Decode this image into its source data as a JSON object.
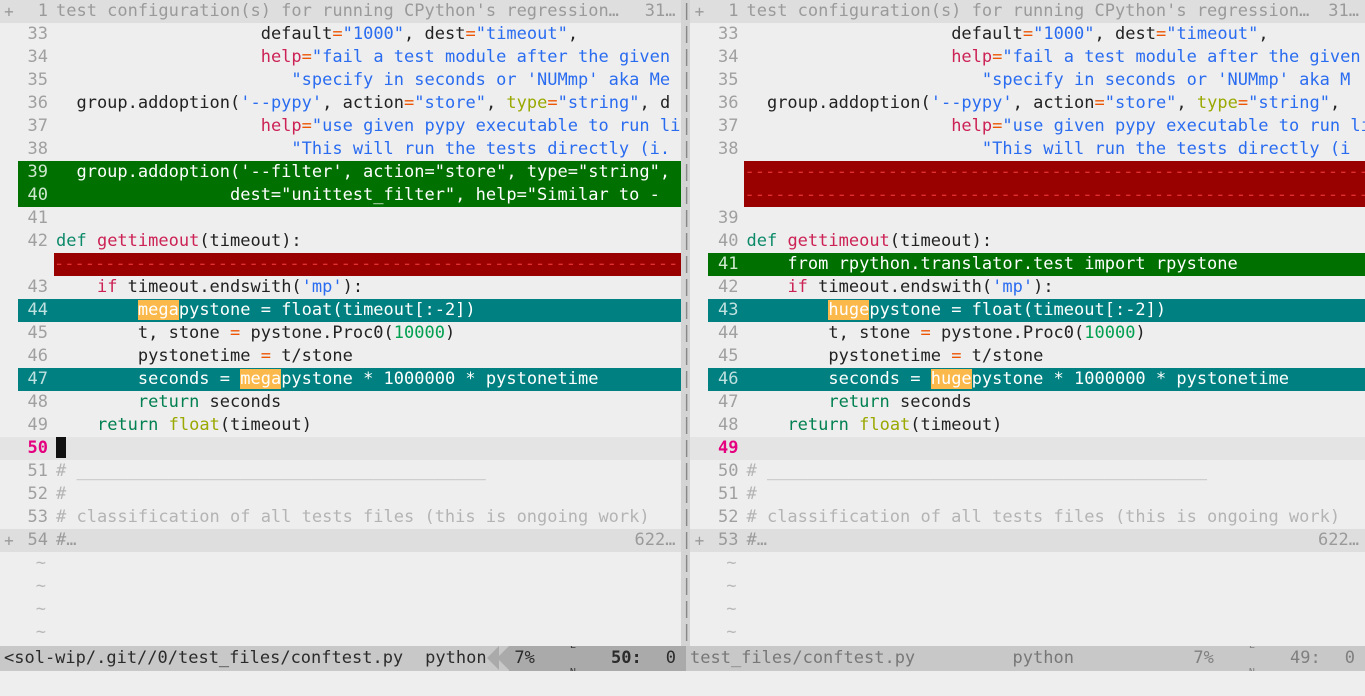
{
  "app": {
    "name": "vim-diff",
    "colors": {
      "background": "#eeeeee",
      "diff_add": "#007000",
      "diff_change": "#008080",
      "diff_delete": "#990000",
      "diff_text_highlight": "#fbb84b",
      "cursor_line_number": "#e5007f",
      "statusline_bg": "#c8c8c8",
      "statusline_accent": "#aaaaaa",
      "split_bar": "#d4d4d4"
    }
  },
  "left_pane": {
    "fold_top": {
      "fold_marker": "+",
      "line_number": "1",
      "text": "test configuration(s) for running CPython's regression…",
      "count": "31…"
    },
    "lines": [
      {
        "num": "33",
        "kind": "context",
        "segments": [
          {
            "t": "                    ",
            "c": "plain"
          },
          {
            "t": "default",
            "c": "plain"
          },
          {
            "t": "=",
            "c": "op"
          },
          {
            "t": "\"1000\"",
            "c": "str"
          },
          {
            "t": ", ",
            "c": "plain"
          },
          {
            "t": "dest",
            "c": "plain"
          },
          {
            "t": "=",
            "c": "op"
          },
          {
            "t": "\"timeout\"",
            "c": "str"
          },
          {
            "t": ",",
            "c": "plain"
          }
        ]
      },
      {
        "num": "34",
        "kind": "context",
        "segments": [
          {
            "t": "                    ",
            "c": "plain"
          },
          {
            "t": "help",
            "c": "fn"
          },
          {
            "t": "=",
            "c": "op"
          },
          {
            "t": "\"fail a test module after the given t",
            "c": "str"
          }
        ]
      },
      {
        "num": "35",
        "kind": "context",
        "segments": [
          {
            "t": "                       ",
            "c": "plain"
          },
          {
            "t": "\"specify in seconds or 'NUMmp' aka Me",
            "c": "str"
          }
        ]
      },
      {
        "num": "36",
        "kind": "context",
        "segments": [
          {
            "t": "  group.addoption(",
            "c": "plain"
          },
          {
            "t": "'--pypy'",
            "c": "str"
          },
          {
            "t": ", ",
            "c": "plain"
          },
          {
            "t": "action",
            "c": "plain"
          },
          {
            "t": "=",
            "c": "op"
          },
          {
            "t": "\"store\"",
            "c": "str"
          },
          {
            "t": ", ",
            "c": "plain"
          },
          {
            "t": "type",
            "c": "builtin"
          },
          {
            "t": "=",
            "c": "op"
          },
          {
            "t": "\"string\"",
            "c": "str"
          },
          {
            "t": ", d",
            "c": "plain"
          }
        ]
      },
      {
        "num": "37",
        "kind": "context",
        "segments": [
          {
            "t": "                    ",
            "c": "plain"
          },
          {
            "t": "help",
            "c": "fn"
          },
          {
            "t": "=",
            "c": "op"
          },
          {
            "t": "\"use given pypy executable to run lib",
            "c": "str"
          }
        ]
      },
      {
        "num": "38",
        "kind": "context",
        "segments": [
          {
            "t": "                       ",
            "c": "plain"
          },
          {
            "t": "\"This will run the tests directly (i.",
            "c": "str"
          }
        ]
      },
      {
        "num": "39",
        "kind": "add",
        "segments": [
          {
            "t": "  group.addoption('--filter', action=\"store\", type=\"string\",",
            "c": "plain"
          }
        ]
      },
      {
        "num": "40",
        "kind": "add",
        "segments": [
          {
            "t": "                 dest=\"unittest_filter\", help=\"Similar to -",
            "c": "plain"
          }
        ]
      },
      {
        "num": "41",
        "kind": "context",
        "segments": [
          {
            "t": "",
            "c": "plain"
          }
        ]
      },
      {
        "num": "42",
        "kind": "context",
        "segments": [
          {
            "t": "def ",
            "c": "kw"
          },
          {
            "t": "gettimeout",
            "c": "fn"
          },
          {
            "t": "(timeout):",
            "c": "plain"
          }
        ]
      },
      {
        "num": "",
        "kind": "delete",
        "segments": []
      },
      {
        "num": "43",
        "kind": "context",
        "segments": [
          {
            "t": "    ",
            "c": "plain"
          },
          {
            "t": "if",
            "c": "fn"
          },
          {
            "t": " timeout.endswith(",
            "c": "plain"
          },
          {
            "t": "'mp'",
            "c": "str"
          },
          {
            "t": "):",
            "c": "plain"
          }
        ]
      },
      {
        "num": "44",
        "kind": "change",
        "segments": [
          {
            "t": "        ",
            "c": "plain"
          },
          {
            "t": "mega",
            "c": "hl-word"
          },
          {
            "t": "pystone = float(timeout[:-2])",
            "c": "plain"
          }
        ]
      },
      {
        "num": "45",
        "kind": "context",
        "segments": [
          {
            "t": "        t, stone ",
            "c": "plain"
          },
          {
            "t": "=",
            "c": "op"
          },
          {
            "t": " pystone.Proc0(",
            "c": "plain"
          },
          {
            "t": "10000",
            "c": "num"
          },
          {
            "t": ")",
            "c": "plain"
          }
        ]
      },
      {
        "num": "46",
        "kind": "context",
        "segments": [
          {
            "t": "        pystonetime ",
            "c": "plain"
          },
          {
            "t": "=",
            "c": "op"
          },
          {
            "t": " t/stone",
            "c": "plain"
          }
        ]
      },
      {
        "num": "47",
        "kind": "change",
        "segments": [
          {
            "t": "        seconds = ",
            "c": "plain"
          },
          {
            "t": "mega",
            "c": "hl-word"
          },
          {
            "t": "pystone * 1000000 * pystonetime",
            "c": "plain"
          }
        ]
      },
      {
        "num": "48",
        "kind": "context",
        "segments": [
          {
            "t": "        ",
            "c": "plain"
          },
          {
            "t": "return",
            "c": "kw2"
          },
          {
            "t": " seconds",
            "c": "plain"
          }
        ]
      },
      {
        "num": "49",
        "kind": "context",
        "segments": [
          {
            "t": "    ",
            "c": "plain"
          },
          {
            "t": "return",
            "c": "kw2"
          },
          {
            "t": " ",
            "c": "plain"
          },
          {
            "t": "float",
            "c": "builtin"
          },
          {
            "t": "(timeout)",
            "c": "plain"
          }
        ]
      },
      {
        "num": "50",
        "kind": "cursorline",
        "segments": [
          {
            "t": "",
            "c": "cursor"
          }
        ]
      },
      {
        "num": "51",
        "kind": "context",
        "segments": [
          {
            "t": "# ________________________________________",
            "c": "comment"
          }
        ]
      },
      {
        "num": "52",
        "kind": "context",
        "segments": [
          {
            "t": "#",
            "c": "comment"
          }
        ]
      },
      {
        "num": "53",
        "kind": "context",
        "segments": [
          {
            "t": "# classification of all tests files (this is ongoing work)",
            "c": "comment"
          }
        ]
      }
    ],
    "fold_bottom": {
      "fold_marker": "+",
      "line_number": "54",
      "text": "#…",
      "count": "622…"
    },
    "tildes": [
      "~",
      "~",
      "~",
      "~"
    ],
    "status": {
      "file": "<sol-wip/.git//0/test_files/conftest.py",
      "filetype": "python",
      "percent": "7%",
      "lnglyph_top": "L",
      "lnglyph_bottom": "N",
      "line": "50:",
      "column": "0"
    }
  },
  "right_pane": {
    "fold_top": {
      "fold_marker": "+",
      "line_number": "1",
      "text": "test configuration(s) for running CPython's regression…",
      "count": "31…"
    },
    "lines": [
      {
        "num": "33",
        "kind": "context",
        "segments": [
          {
            "t": "                    ",
            "c": "plain"
          },
          {
            "t": "default",
            "c": "plain"
          },
          {
            "t": "=",
            "c": "op"
          },
          {
            "t": "\"1000\"",
            "c": "str"
          },
          {
            "t": ", ",
            "c": "plain"
          },
          {
            "t": "dest",
            "c": "plain"
          },
          {
            "t": "=",
            "c": "op"
          },
          {
            "t": "\"timeout\"",
            "c": "str"
          },
          {
            "t": ",",
            "c": "plain"
          }
        ]
      },
      {
        "num": "34",
        "kind": "context",
        "segments": [
          {
            "t": "                    ",
            "c": "plain"
          },
          {
            "t": "help",
            "c": "fn"
          },
          {
            "t": "=",
            "c": "op"
          },
          {
            "t": "\"fail a test module after the given",
            "c": "str"
          }
        ]
      },
      {
        "num": "35",
        "kind": "context",
        "segments": [
          {
            "t": "                       ",
            "c": "plain"
          },
          {
            "t": "\"specify in seconds or 'NUMmp' aka M",
            "c": "str"
          }
        ]
      },
      {
        "num": "36",
        "kind": "context",
        "segments": [
          {
            "t": "  group.addoption(",
            "c": "plain"
          },
          {
            "t": "'--pypy'",
            "c": "str"
          },
          {
            "t": ", ",
            "c": "plain"
          },
          {
            "t": "action",
            "c": "plain"
          },
          {
            "t": "=",
            "c": "op"
          },
          {
            "t": "\"store\"",
            "c": "str"
          },
          {
            "t": ", ",
            "c": "plain"
          },
          {
            "t": "type",
            "c": "builtin"
          },
          {
            "t": "=",
            "c": "op"
          },
          {
            "t": "\"string\"",
            "c": "str"
          },
          {
            "t": ",",
            "c": "plain"
          }
        ]
      },
      {
        "num": "37",
        "kind": "context",
        "segments": [
          {
            "t": "                    ",
            "c": "plain"
          },
          {
            "t": "help",
            "c": "fn"
          },
          {
            "t": "=",
            "c": "op"
          },
          {
            "t": "\"use given pypy executable to run li",
            "c": "str"
          }
        ]
      },
      {
        "num": "38",
        "kind": "context",
        "segments": [
          {
            "t": "                       ",
            "c": "plain"
          },
          {
            "t": "\"This will run the tests directly (i",
            "c": "str"
          }
        ]
      },
      {
        "num": "",
        "kind": "delete",
        "segments": []
      },
      {
        "num": "",
        "kind": "delete",
        "segments": []
      },
      {
        "num": "39",
        "kind": "context",
        "segments": [
          {
            "t": "",
            "c": "plain"
          }
        ]
      },
      {
        "num": "40",
        "kind": "context",
        "segments": [
          {
            "t": "def ",
            "c": "kw"
          },
          {
            "t": "gettimeout",
            "c": "fn"
          },
          {
            "t": "(timeout):",
            "c": "plain"
          }
        ]
      },
      {
        "num": "41",
        "kind": "add",
        "segments": [
          {
            "t": "    from rpython.translator.test import rpystone",
            "c": "plain"
          }
        ]
      },
      {
        "num": "42",
        "kind": "context",
        "segments": [
          {
            "t": "    ",
            "c": "plain"
          },
          {
            "t": "if",
            "c": "fn"
          },
          {
            "t": " timeout.endswith(",
            "c": "plain"
          },
          {
            "t": "'mp'",
            "c": "str"
          },
          {
            "t": "):",
            "c": "plain"
          }
        ]
      },
      {
        "num": "43",
        "kind": "change",
        "segments": [
          {
            "t": "        ",
            "c": "plain"
          },
          {
            "t": "huge",
            "c": "hl-word"
          },
          {
            "t": "pystone = float(timeout[:-2])",
            "c": "plain"
          }
        ]
      },
      {
        "num": "44",
        "kind": "context",
        "segments": [
          {
            "t": "        t, stone ",
            "c": "plain"
          },
          {
            "t": "=",
            "c": "op"
          },
          {
            "t": " pystone.Proc0(",
            "c": "plain"
          },
          {
            "t": "10000",
            "c": "num"
          },
          {
            "t": ")",
            "c": "plain"
          }
        ]
      },
      {
        "num": "45",
        "kind": "context",
        "segments": [
          {
            "t": "        pystonetime ",
            "c": "plain"
          },
          {
            "t": "=",
            "c": "op"
          },
          {
            "t": " t/stone",
            "c": "plain"
          }
        ]
      },
      {
        "num": "46",
        "kind": "change",
        "segments": [
          {
            "t": "        seconds = ",
            "c": "plain"
          },
          {
            "t": "huge",
            "c": "hl-word"
          },
          {
            "t": "pystone * 1000000 * pystonetime",
            "c": "plain"
          }
        ]
      },
      {
        "num": "47",
        "kind": "context",
        "segments": [
          {
            "t": "        ",
            "c": "plain"
          },
          {
            "t": "return",
            "c": "kw2"
          },
          {
            "t": " seconds",
            "c": "plain"
          }
        ]
      },
      {
        "num": "48",
        "kind": "context",
        "segments": [
          {
            "t": "    ",
            "c": "plain"
          },
          {
            "t": "return",
            "c": "kw2"
          },
          {
            "t": " ",
            "c": "plain"
          },
          {
            "t": "float",
            "c": "builtin"
          },
          {
            "t": "(timeout)",
            "c": "plain"
          }
        ]
      },
      {
        "num": "49",
        "kind": "cursorline",
        "segments": [
          {
            "t": "",
            "c": "plain"
          }
        ]
      },
      {
        "num": "50",
        "kind": "context",
        "segments": [
          {
            "t": "# ___________________________________________",
            "c": "comment"
          }
        ]
      },
      {
        "num": "51",
        "kind": "context",
        "segments": [
          {
            "t": "#",
            "c": "comment"
          }
        ]
      },
      {
        "num": "52",
        "kind": "context",
        "segments": [
          {
            "t": "# classification of all tests files (this is ongoing work)",
            "c": "comment"
          }
        ]
      }
    ],
    "fold_bottom": {
      "fold_marker": "+",
      "line_number": "53",
      "text": "#…",
      "count": "622…"
    },
    "tildes": [
      "~",
      "~",
      "~",
      "~"
    ],
    "status": {
      "file": "test_files/conftest.py",
      "filetype": "python",
      "percent": "7%",
      "lnglyph_top": "L",
      "lnglyph_bottom": "N",
      "line": "49:",
      "column": "0"
    }
  },
  "split_bar": {
    "marker": "|",
    "fold_marker": "+"
  }
}
